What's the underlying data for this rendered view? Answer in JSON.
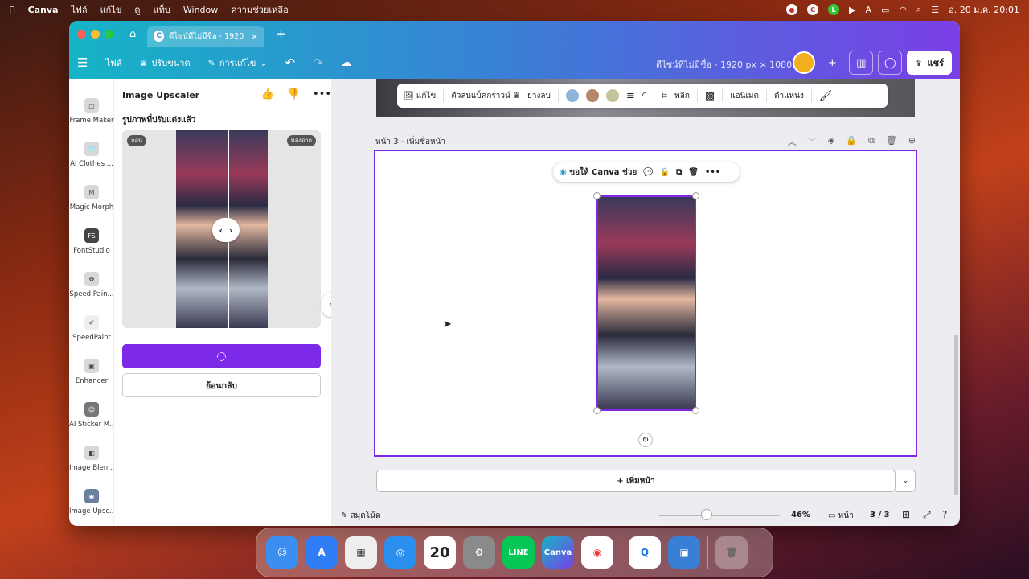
{
  "menubar": {
    "app": "Canva",
    "items": [
      "ไฟล์",
      "แก้ไข",
      "ดู",
      "แท็บ",
      "Window",
      "ความช่วยเหลือ"
    ],
    "clock": "อ. 20 ม.ค.  20:01"
  },
  "browser": {
    "tab_title": "ดีไซน์ที่ไม่มีชื่อ - 1920 ..."
  },
  "header": {
    "file": "ไฟล์",
    "resize": "ปรับขนาด",
    "edit": "การแก้ไข",
    "doc_title": "ดีไซน์ที่ไม่มีชื่อ - 1920 px × 1080 px",
    "share": "แชร์"
  },
  "sidebar": {
    "items": [
      {
        "label": "Frame Maker",
        "icon": "frame-icon"
      },
      {
        "label": "AI Clothes ...",
        "icon": "shirt-icon"
      },
      {
        "label": "Magic Morph",
        "icon": "morph-icon"
      },
      {
        "label": "FontStudio",
        "icon": "fs-icon"
      },
      {
        "label": "Speed Pain...",
        "icon": "paint-icon"
      },
      {
        "label": "SpeedPaint",
        "icon": "paint2-icon"
      },
      {
        "label": "Enhancer",
        "icon": "enhance-icon"
      },
      {
        "label": "AI Sticker M...",
        "icon": "sticker-icon"
      },
      {
        "label": "Image Blen...",
        "icon": "blend-icon"
      },
      {
        "label": "Image Upsc...",
        "icon": "upscale-icon"
      }
    ]
  },
  "panel": {
    "title": "Image Upscaler",
    "subtitle": "รูปภาพที่ปรับแต่งแล้ว",
    "before": "ก่อน",
    "after": "หลังจาก",
    "back": "ย้อนกลับ"
  },
  "toolbar": {
    "edit": "แก้ไข",
    "bg_remove": "ตัวลบแบ็คกราวน์",
    "eraser": "ยางลบ",
    "flip": "พลิก",
    "animate": "แอนิเมต",
    "position": "ตำแหน่ง",
    "colors": [
      "#8eb4dc",
      "#b6866a",
      "#c4c49a"
    ]
  },
  "page": {
    "label": "หน้า 3 - เพิ่มชื่อหน้า",
    "ask": "ขอให้ Canva ช่วย",
    "add_page": "+ เพิ่มหน้า"
  },
  "footer": {
    "notes": "สมุดโน้ต",
    "zoom": "46%",
    "pages_label": "หน้า",
    "pages": "3 / 3"
  }
}
